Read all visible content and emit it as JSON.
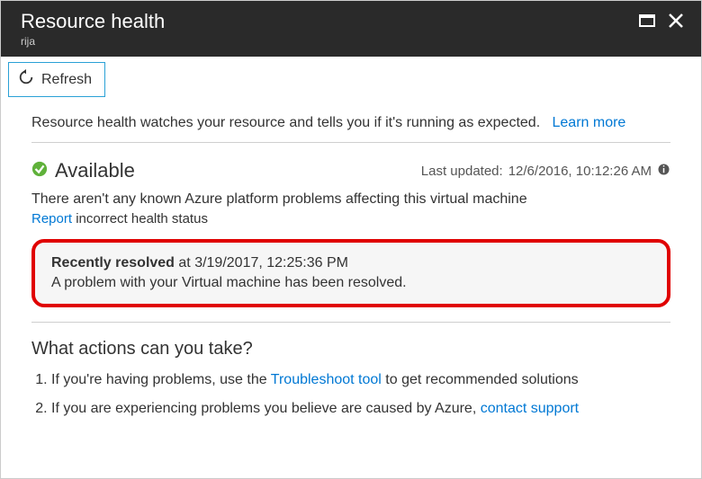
{
  "header": {
    "title": "Resource health",
    "subtitle": "rija"
  },
  "toolbar": {
    "refresh_label": "Refresh"
  },
  "intro": {
    "text": "Resource health watches your resource and tells you if it's running as expected.",
    "learn_more": "Learn more"
  },
  "status": {
    "label": "Available",
    "last_updated_prefix": "Last updated:",
    "last_updated_value": "12/6/2016, 10:12:26 AM",
    "message": "There aren't any known Azure platform problems affecting this virtual machine",
    "report_link": "Report",
    "report_suffix": " incorrect health status"
  },
  "resolved": {
    "label": "Recently resolved",
    "at_prefix": " at ",
    "timestamp": "3/19/2017, 12:25:36 PM",
    "description": "A problem with your Virtual machine has been resolved."
  },
  "actions": {
    "heading": "What actions can you take?",
    "item1_prefix": "If you're having problems, use the ",
    "item1_link": "Troubleshoot tool",
    "item1_suffix": " to get recommended solutions",
    "item2_prefix": "If you are experiencing problems you believe are caused by Azure, ",
    "item2_link": "contact support"
  }
}
